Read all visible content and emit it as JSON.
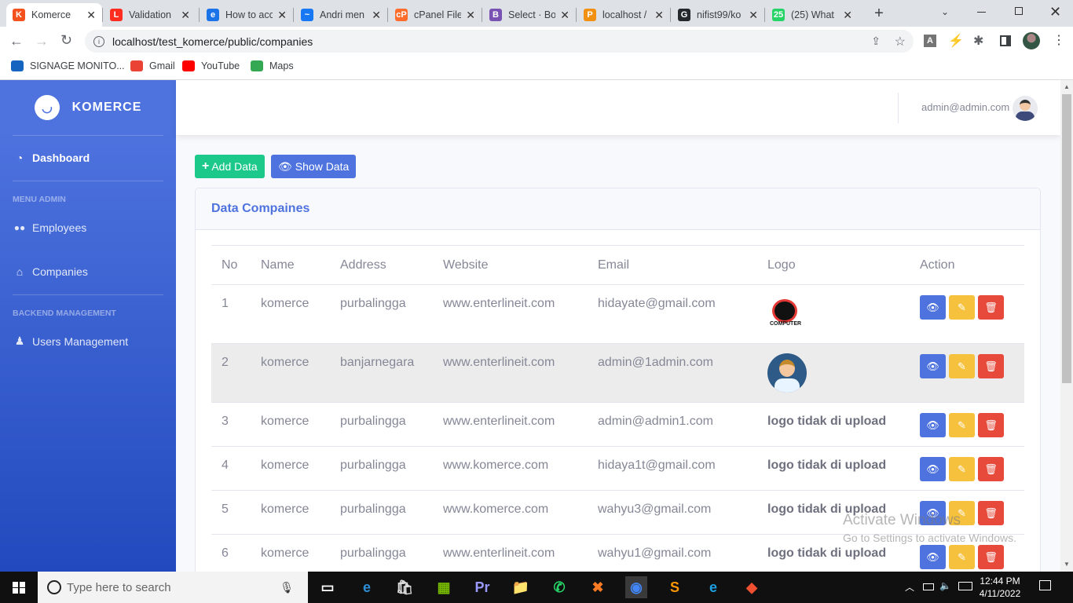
{
  "browser": {
    "tabs": [
      {
        "title": "Komerce",
        "icon": "laravel-icon",
        "color": "#f4511e",
        "glyph": "K"
      },
      {
        "title": "Validation",
        "icon": "laravel-icon",
        "color": "#ff2d20",
        "glyph": "L"
      },
      {
        "title": "How to acc",
        "icon": "edureka-icon",
        "color": "#1a73e8",
        "glyph": "e"
      },
      {
        "title": "Andri men",
        "icon": "messenger-icon",
        "color": "#1877f2",
        "glyph": "~"
      },
      {
        "title": "cPanel File",
        "icon": "cpanel-icon",
        "color": "#ff6c2c",
        "glyph": "cP"
      },
      {
        "title": "Select · Bo",
        "icon": "bootstrap-icon",
        "color": "#7952b3",
        "glyph": "B"
      },
      {
        "title": "localhost /",
        "icon": "phpmyadmin-icon",
        "color": "#f29111",
        "glyph": "P"
      },
      {
        "title": "nifist99/ko",
        "icon": "github-icon",
        "color": "#24292e",
        "glyph": "G"
      },
      {
        "title": "(25) What",
        "icon": "whatsapp-icon",
        "color": "#25d366",
        "glyph": "25"
      }
    ],
    "url": "localhost/test_komerce/public/companies",
    "bookmarks": [
      {
        "label": "SIGNAGE MONITO...",
        "icon": "p-icon",
        "color": "#1565c0"
      },
      {
        "label": "Gmail",
        "icon": "gmail-icon",
        "color": "#ea4335"
      },
      {
        "label": "YouTube",
        "icon": "youtube-icon",
        "color": "#ff0000"
      },
      {
        "label": "Maps",
        "icon": "maps-icon",
        "color": "#34a853"
      }
    ]
  },
  "app": {
    "brand": "KOMERCE",
    "user_email": "admin@admin.com",
    "sidebar": {
      "dashboard": "Dashboard",
      "heading_admin": "MENU ADMIN",
      "employees": "Employees",
      "companies": "Companies",
      "heading_backend": "BACKEND MANAGEMENT",
      "users": "Users Management"
    },
    "buttons": {
      "add": "Add Data",
      "show": "Show Data"
    },
    "card_title": "Data Compaines",
    "columns": [
      "No",
      "Name",
      "Address",
      "Website",
      "Email",
      "Logo",
      "Action"
    ],
    "rows": [
      {
        "no": "1",
        "name": "komerce",
        "address": "purbalingga",
        "website": "www.enterlineit.com",
        "email": "hidayate@gmail.com",
        "logo": "image",
        "logo_caption": "COMPUTER"
      },
      {
        "no": "2",
        "name": "komerce",
        "address": "banjarnegara",
        "website": "www.enterlineit.com",
        "email": "admin@1admin.com",
        "logo": "avatar"
      },
      {
        "no": "3",
        "name": "komerce",
        "address": "purbalingga",
        "website": "www.enterlineit.com",
        "email": "admin@admin1.com",
        "logo": "logo tidak di upload"
      },
      {
        "no": "4",
        "name": "komerce",
        "address": "purbalingga",
        "website": "www.komerce.com",
        "email": "hidaya1t@gmail.com",
        "logo": "logo tidak di upload"
      },
      {
        "no": "5",
        "name": "komerce",
        "address": "purbalingga",
        "website": "www.komerce.com",
        "email": "wahyu3@gmail.com",
        "logo": "logo tidak di upload"
      },
      {
        "no": "6",
        "name": "komerce",
        "address": "purbalingga",
        "website": "www.enterlineit.com",
        "email": "wahyu1@gmail.com",
        "logo": "logo tidak di upload"
      }
    ],
    "colors": {
      "primary": "#4e73df",
      "success": "#1cc88a",
      "warning": "#f6c23e",
      "danger": "#e74a3b"
    }
  },
  "watermark": {
    "line1": "Activate Windows",
    "line2": "Go to Settings to activate Windows."
  },
  "taskbar": {
    "search_placeholder": "Type here to search",
    "time": "12:44 PM",
    "date": "4/11/2022"
  }
}
